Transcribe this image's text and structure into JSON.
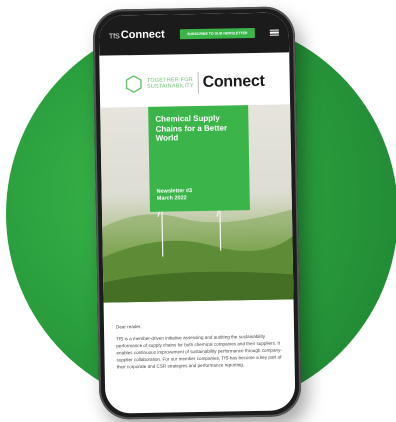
{
  "topbar": {
    "brand_prefix": "TfS",
    "brand_name": "Connect",
    "subscribe_label": "Subscribe to our newsletter"
  },
  "logo": {
    "tfs_line1": "TOGETHER FOR",
    "tfs_line2": "SUSTAINABILITY",
    "connect": "Connect"
  },
  "hero": {
    "title": "Chemical Supply Chains for a Better World",
    "issue_line1": "Newsletter #3",
    "issue_line2": "March 2022"
  },
  "content": {
    "greeting": "Dear reader,",
    "body": "TfS is a member-driven initiative assessing and auditing the sustainability performance of supply chains for both chemical companies and their suppliers. It enables continuous improvement of sustainability performance through company-supplier collaboration. For our member companies, TfS has become a key part of their corporate and CSR strategies and performance reporting."
  },
  "icons": [
    "menu-icon",
    "hexagon-logo-icon",
    "wind-turbine-icon"
  ],
  "colors": {
    "brand_green": "#3bb54a",
    "dark_bar": "#1b1b1b",
    "background_circle": "#2a9e3d"
  }
}
